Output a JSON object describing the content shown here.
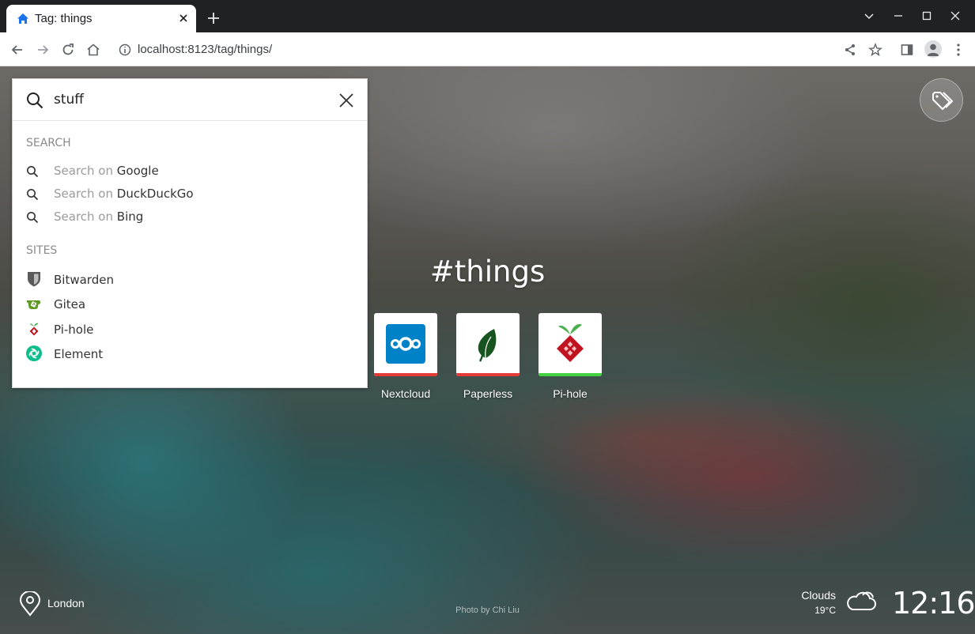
{
  "browser": {
    "tab_title": "Tag: things",
    "url": "localhost:8123/tag/things/"
  },
  "search": {
    "query": "stuff",
    "section_search": "SEARCH",
    "engines": [
      {
        "prefix": "Search on",
        "name": "Google"
      },
      {
        "prefix": "Search on",
        "name": "DuckDuckGo"
      },
      {
        "prefix": "Search on",
        "name": "Bing"
      }
    ],
    "section_sites": "SITES",
    "sites": [
      {
        "name": "Bitwarden",
        "icon": "bitwarden-shield-icon"
      },
      {
        "name": "Gitea",
        "icon": "gitea-icon"
      },
      {
        "name": "Pi-hole",
        "icon": "pihole-icon"
      },
      {
        "name": "Element",
        "icon": "element-icon"
      }
    ]
  },
  "page": {
    "title": "#things",
    "tiles": [
      {
        "label": "Nextcloud",
        "icon": "nextcloud-icon",
        "status_color": "#e53935"
      },
      {
        "label": "Paperless",
        "icon": "paperless-leaf-icon",
        "status_color": "#e53935"
      },
      {
        "label": "Pi-hole",
        "icon": "pihole-icon",
        "status_color": "#43d23f"
      }
    ]
  },
  "footer": {
    "location": "London",
    "photo_credit": "Photo by Chi Liu",
    "weather_condition": "Clouds",
    "temperature": "19°C",
    "time": "12:16"
  }
}
